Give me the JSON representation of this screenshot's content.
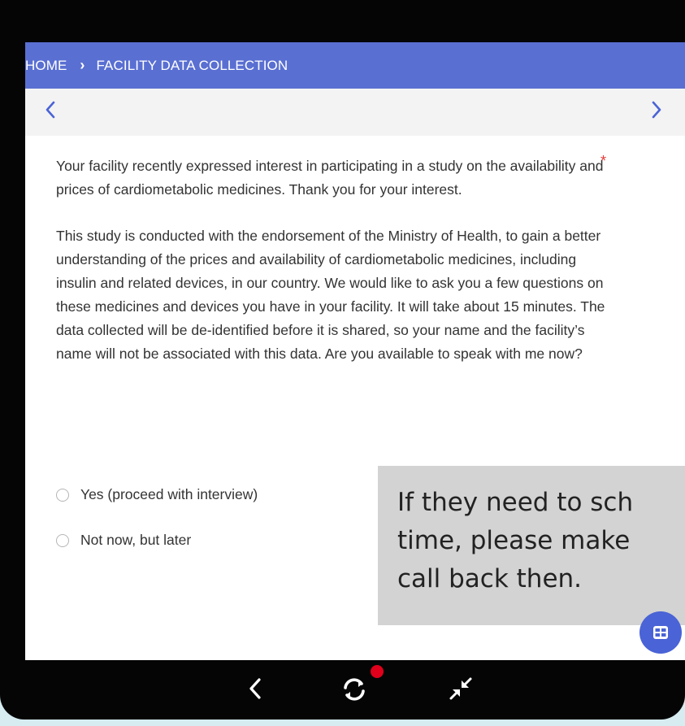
{
  "breadcrumb": {
    "home": "HOME",
    "separator": "›",
    "current": "FACILITY DATA COLLECTION"
  },
  "pager": {
    "prev_icon": "chevron-left-icon",
    "next_icon": "chevron-right-icon"
  },
  "question": {
    "paragraph1": "Your facility recently expressed interest in participating in a study on the availability and prices of cardiometabolic medicines. Thank you for your interest.",
    "paragraph2": "This study is conducted with the endorsement of the Ministry of Health, to gain a better understanding of the prices and availability of cardiometabolic medicines, including insulin and related devices, in our country. We would like to ask you a few questions on these medicines and devices you have in your facility. It will take about 15 minutes. The data collected will be de-identified before it is shared, so your name and the facility’s name will not be associated with this data. Are you available to speak with me now?",
    "required_marker": "*"
  },
  "options": [
    {
      "label": "Yes (proceed with interview)",
      "selected": false
    },
    {
      "label": "Not now, but later",
      "selected": false
    }
  ],
  "callout": {
    "line1": "If they need to sch",
    "line2": "time, please make",
    "line3": "call back then."
  },
  "colors": {
    "header": "#5a6fd2",
    "accent": "#4a63d6",
    "required": "#e53935",
    "notification_dot": "#e0001b"
  }
}
